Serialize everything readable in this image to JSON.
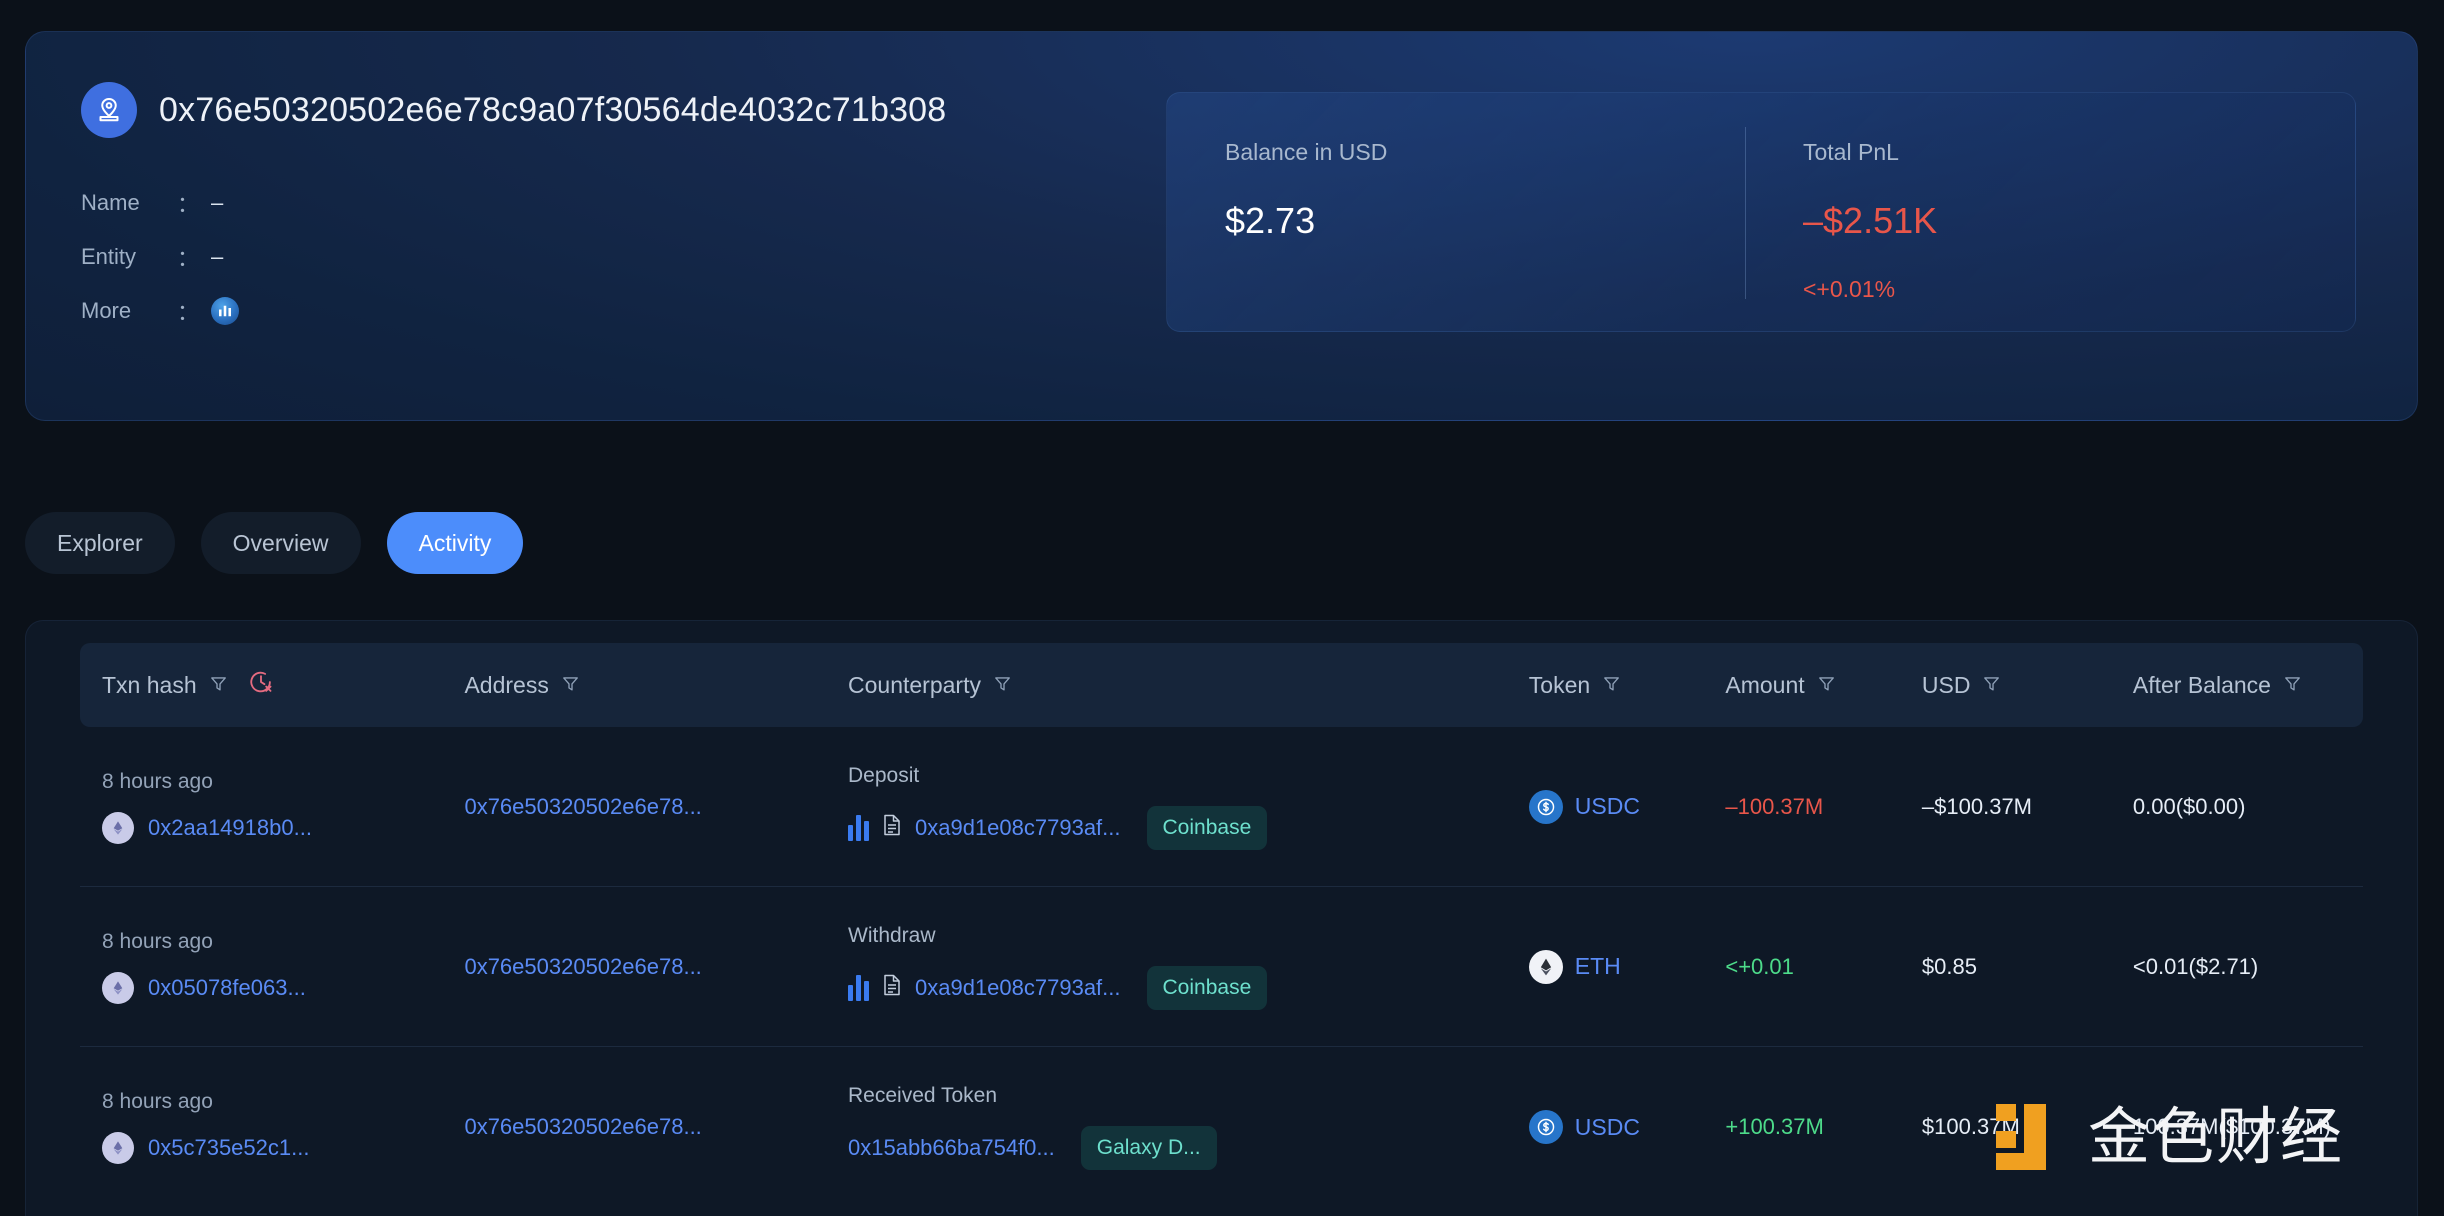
{
  "profile": {
    "address": "0x76e50320502e6e78c9a07f30564de4032c71b308",
    "avatar_icon": "map-pin-icon",
    "fields": [
      {
        "label": "Name",
        "colon": "：",
        "value": "–"
      },
      {
        "label": "Entity",
        "colon": "：",
        "value": "–"
      },
      {
        "label": "More",
        "colon": "：",
        "value": "",
        "icon": "debank-chart-icon"
      }
    ]
  },
  "stats": {
    "balance": {
      "label": "Balance in USD",
      "value": "$2.73"
    },
    "pnl": {
      "label": "Total PnL",
      "value": "–$2.51K",
      "sub": "<+0.01%",
      "color": "#e8564a"
    }
  },
  "tabs": [
    {
      "label": "Explorer",
      "active": false
    },
    {
      "label": "Overview",
      "active": false
    },
    {
      "label": "Activity",
      "active": true
    }
  ],
  "table": {
    "columns": [
      {
        "key": "txn_hash",
        "label": "Txn hash",
        "filter": true,
        "extra_icon": "clock-x-icon"
      },
      {
        "key": "address",
        "label": "Address",
        "filter": true
      },
      {
        "key": "counterparty",
        "label": "Counterparty",
        "filter": true
      },
      {
        "key": "token",
        "label": "Token",
        "filter": true
      },
      {
        "key": "amount",
        "label": "Amount",
        "filter": true
      },
      {
        "key": "usd",
        "label": "USD",
        "filter": true
      },
      {
        "key": "after_balance",
        "label": "After Balance",
        "filter": true
      }
    ],
    "rows": [
      {
        "time": "8 hours ago",
        "hash": "0x2aa14918b0...",
        "chain_icon": "ethereum-icon",
        "address": "0x76e50320502e6e78...",
        "cp_type": "Deposit",
        "cp_has_bars": true,
        "cp_has_doc": true,
        "cp_address": "0xa9d1e08c7793af...",
        "cp_tag": "Coinbase",
        "token": "USDC",
        "token_icon": "usdc-icon",
        "amount": "–100.37M",
        "amount_sign": "negative",
        "usd": "–$100.37M",
        "after_balance": "0.00($0.00)"
      },
      {
        "time": "8 hours ago",
        "hash": "0x05078fe063...",
        "chain_icon": "ethereum-icon",
        "address": "0x76e50320502e6e78...",
        "cp_type": "Withdraw",
        "cp_has_bars": true,
        "cp_has_doc": true,
        "cp_address": "0xa9d1e08c7793af...",
        "cp_tag": "Coinbase",
        "token": "ETH",
        "token_icon": "ethereum-icon",
        "amount": "<+0.01",
        "amount_sign": "positive",
        "usd": "$0.85",
        "after_balance": "<0.01($2.71)"
      },
      {
        "time": "8 hours ago",
        "hash": "0x5c735e52c1...",
        "chain_icon": "ethereum-icon",
        "address": "0x76e50320502e6e78...",
        "cp_type": "Received Token",
        "cp_has_bars": false,
        "cp_has_doc": false,
        "cp_address": "0x15abb66ba754f0...",
        "cp_tag": "Galaxy D...",
        "token": "USDC",
        "token_icon": "usdc-icon",
        "amount": "+100.37M",
        "amount_sign": "positive",
        "usd": "$100.37M",
        "after_balance": "100.37M($100.37M)"
      }
    ]
  },
  "watermark": {
    "text": "金色财经",
    "mark_color": "#f0a020"
  },
  "colors": {
    "accent_blue": "#4c8dfb",
    "link_blue": "#5a8bf5",
    "positive_green": "#4ddb8a",
    "negative_red": "#e8564a",
    "chip_teal": "#6ee0cd",
    "page_bg": "#0b1119",
    "card_bg": "#0e1826"
  }
}
